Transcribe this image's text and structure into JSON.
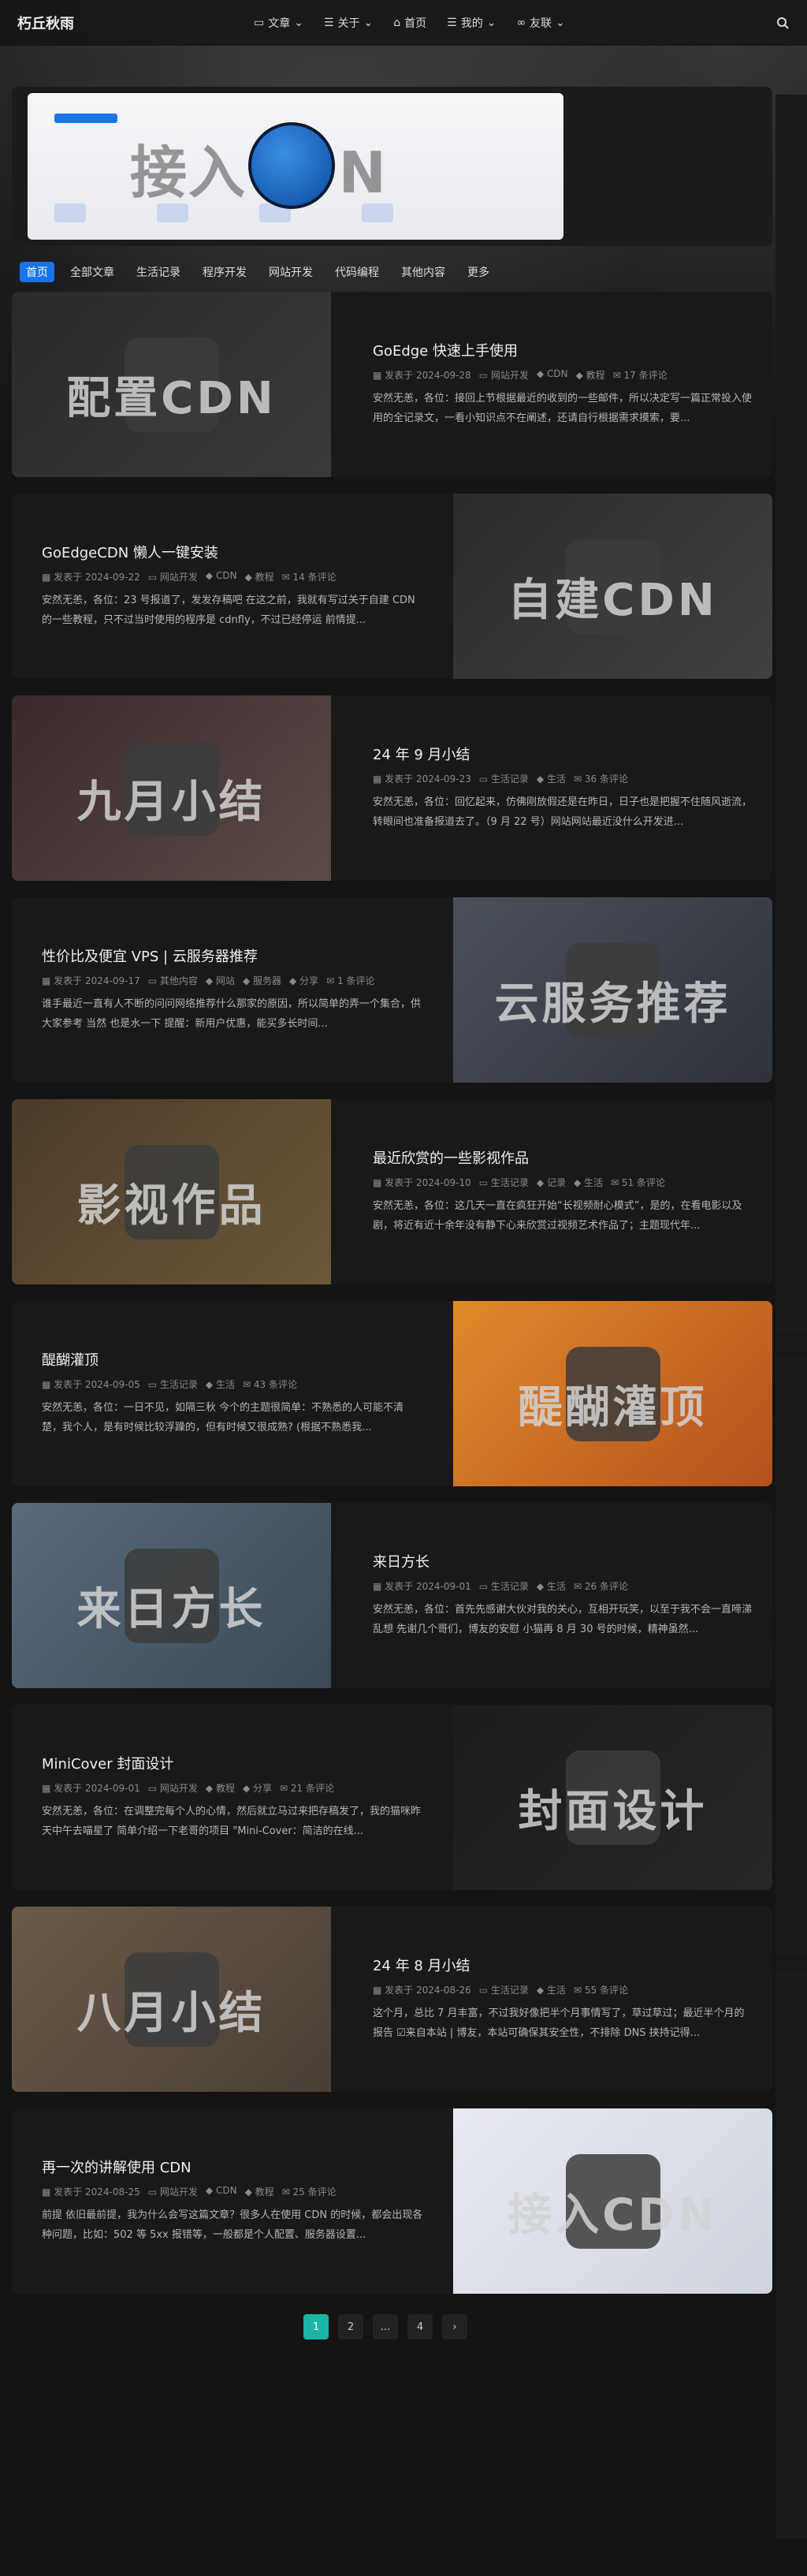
{
  "header": {
    "logo": "朽丘秋雨",
    "nav": [
      {
        "label": "文章",
        "icon": "folder-icon"
      },
      {
        "label": "关于",
        "icon": "list-icon"
      },
      {
        "label": "首页",
        "icon": "home-icon"
      },
      {
        "label": "我的",
        "icon": "list-icon"
      },
      {
        "label": "友联",
        "icon": "link-icon"
      }
    ]
  },
  "banner": {
    "title": "接入CDN"
  },
  "categories": [
    "首页",
    "全部文章",
    "生活记录",
    "程序开发",
    "网站开发",
    "代码编程",
    "其他内容",
    "更多"
  ],
  "meta_prefix": "发表于",
  "posts": [
    {
      "title": "GoEdge 快速上手使用",
      "date": "2024-09-28",
      "cat": "网站开发",
      "tags": [
        "CDN",
        "教程"
      ],
      "comments": "17 条评论",
      "excerpt": "安然无恙，各位：接回上节根据最近的收到的一些邮件，所以决定写一篇正常投入使用的全记录文，一看小知识点不在阐述，还请自行根据需求摸索，要...",
      "thumb_text": "配置CDN",
      "thumb_side": "left",
      "colors": [
        "#2a2a2a",
        "#3a3a3a"
      ]
    },
    {
      "title": "GoEdgeCDN 懒人一键安装",
      "date": "2024-09-22",
      "cat": "网站开发",
      "tags": [
        "CDN",
        "教程"
      ],
      "comments": "14 条评论",
      "excerpt": "安然无恙，各位：23 号报道了，发发存稿吧 在这之前，我就有写过关于自建 CDN 的一些教程，只不过当时使用的程序是 cdnfly，不过已经停运 前情提...",
      "thumb_text": "自建CDN",
      "thumb_side": "right",
      "colors": [
        "#2c2c2c",
        "#404040"
      ]
    },
    {
      "title": "24 年 9 月小结",
      "date": "2024-09-23",
      "cat": "生活记录",
      "tags": [
        "生活"
      ],
      "comments": "36 条评论",
      "excerpt": "安然无恙，各位：回忆起来，仿佛刚放假还是在昨日，日子也是把握不住随风逝流，转眼间也准备报道去了。（9 月 22 号）网站网站最近没什么开发进...",
      "thumb_text": "九月小结",
      "thumb_side": "left",
      "colors": [
        "#3a2a2a",
        "#5a4a48"
      ]
    },
    {
      "title": "性价比及便宜 VPS | 云服务器推荐",
      "date": "2024-09-17",
      "cat": "其他内容",
      "tags": [
        "网站",
        "服务器",
        "分享"
      ],
      "comments": "1 条评论",
      "excerpt": "谁手最近一直有人不断的问问网络推荐什么那家的原因，所以简单的弄一个集合，供大家参考 当然 也是水一下 提醒：新用户优惠，能买多长时间...",
      "thumb_text": "云服务推荐",
      "thumb_side": "right",
      "colors": [
        "#4a4f5a",
        "#2e323a"
      ]
    },
    {
      "title": "最近欣赏的一些影视作品",
      "date": "2024-09-10",
      "cat": "生活记录",
      "tags": [
        "记录",
        "生活"
      ],
      "comments": "51 条评论",
      "excerpt": "安然无恙，各位：这几天一直在疯狂开始“长视频耐心模式”，是的，在看电影以及剧，将近有近十余年没有静下心来欣赏过视频艺术作品了；主题现代年...",
      "thumb_text": "影视作品",
      "thumb_side": "left",
      "colors": [
        "#4a3a2a",
        "#6a5a3a"
      ]
    },
    {
      "title": "醍醐灌顶",
      "date": "2024-09-05",
      "cat": "生活记录",
      "tags": [
        "生活"
      ],
      "comments": "43 条评论",
      "excerpt": "安然无恙，各位：一日不见，如隔三秋 今个的主题很简单：不熟悉的人可能不清楚，我个人，是有时候比较浮躁的，但有时候又很成熟? (根据不熟悉我...",
      "thumb_text": "醍醐灌顶",
      "thumb_side": "right",
      "colors": [
        "#e08a2a",
        "#b4501e"
      ]
    },
    {
      "title": "来日方长",
      "date": "2024-09-01",
      "cat": "生活记录",
      "tags": [
        "生活"
      ],
      "comments": "26 条评论",
      "excerpt": "安然无恙，各位：首先先感谢大伙对我的关心，互相开玩笑，以至于我不会一直啼涕乱想 先谢几个哥们，博友的安慰 小猫再 8 月 30 号的时候，精神虽然...",
      "thumb_text": "来日方长",
      "thumb_side": "left",
      "colors": [
        "#5a6a7a",
        "#3a4a55"
      ]
    },
    {
      "title": "MiniCover 封面设计",
      "date": "2024-09-01",
      "cat": "网站开发",
      "tags": [
        "教程",
        "分享"
      ],
      "comments": "21 条评论",
      "excerpt": "安然无恙，各位：在调整完每个人的心情，然后就立马过来把存稿发了，我的猫咪昨天中午去喵星了 简单介绍一下老哥的项目 \"Mini-Cover：简洁的在线...",
      "thumb_text": "封面设计",
      "thumb_side": "right",
      "colors": [
        "#1c1c1c",
        "#262626"
      ]
    },
    {
      "title": "24 年 8 月小结",
      "date": "2024-08-26",
      "cat": "生活记录",
      "tags": [
        "生活"
      ],
      "comments": "55 条评论",
      "excerpt": "这个月，总比 7 月丰富，不过我好像把半个月事情写了，草过草过；最近半个月的报告 ☑来自本站 | 博友，本站可确保其安全性，不排除 DNS 挟持记得...",
      "thumb_text": "八月小结",
      "thumb_side": "left",
      "colors": [
        "#6a5a4a",
        "#4a3e34"
      ]
    },
    {
      "title": "再一次的讲解使用 CDN",
      "date": "2024-08-25",
      "cat": "网站开发",
      "tags": [
        "CDN",
        "教程"
      ],
      "comments": "25 条评论",
      "excerpt": "前提 依旧最前提，我为什么会写这篇文章？很多人在使用 CDN 的时候，都会出现各种问题，比如：502 等 5xx 报错等，一般都是个人配置、服务器设置...",
      "thumb_text": "接入CDN",
      "thumb_side": "right",
      "colors": [
        "#e8eaf0",
        "#cfd4de"
      ]
    }
  ],
  "pagination": {
    "pages": [
      "1",
      "2",
      "...",
      "4"
    ],
    "current": "1"
  }
}
